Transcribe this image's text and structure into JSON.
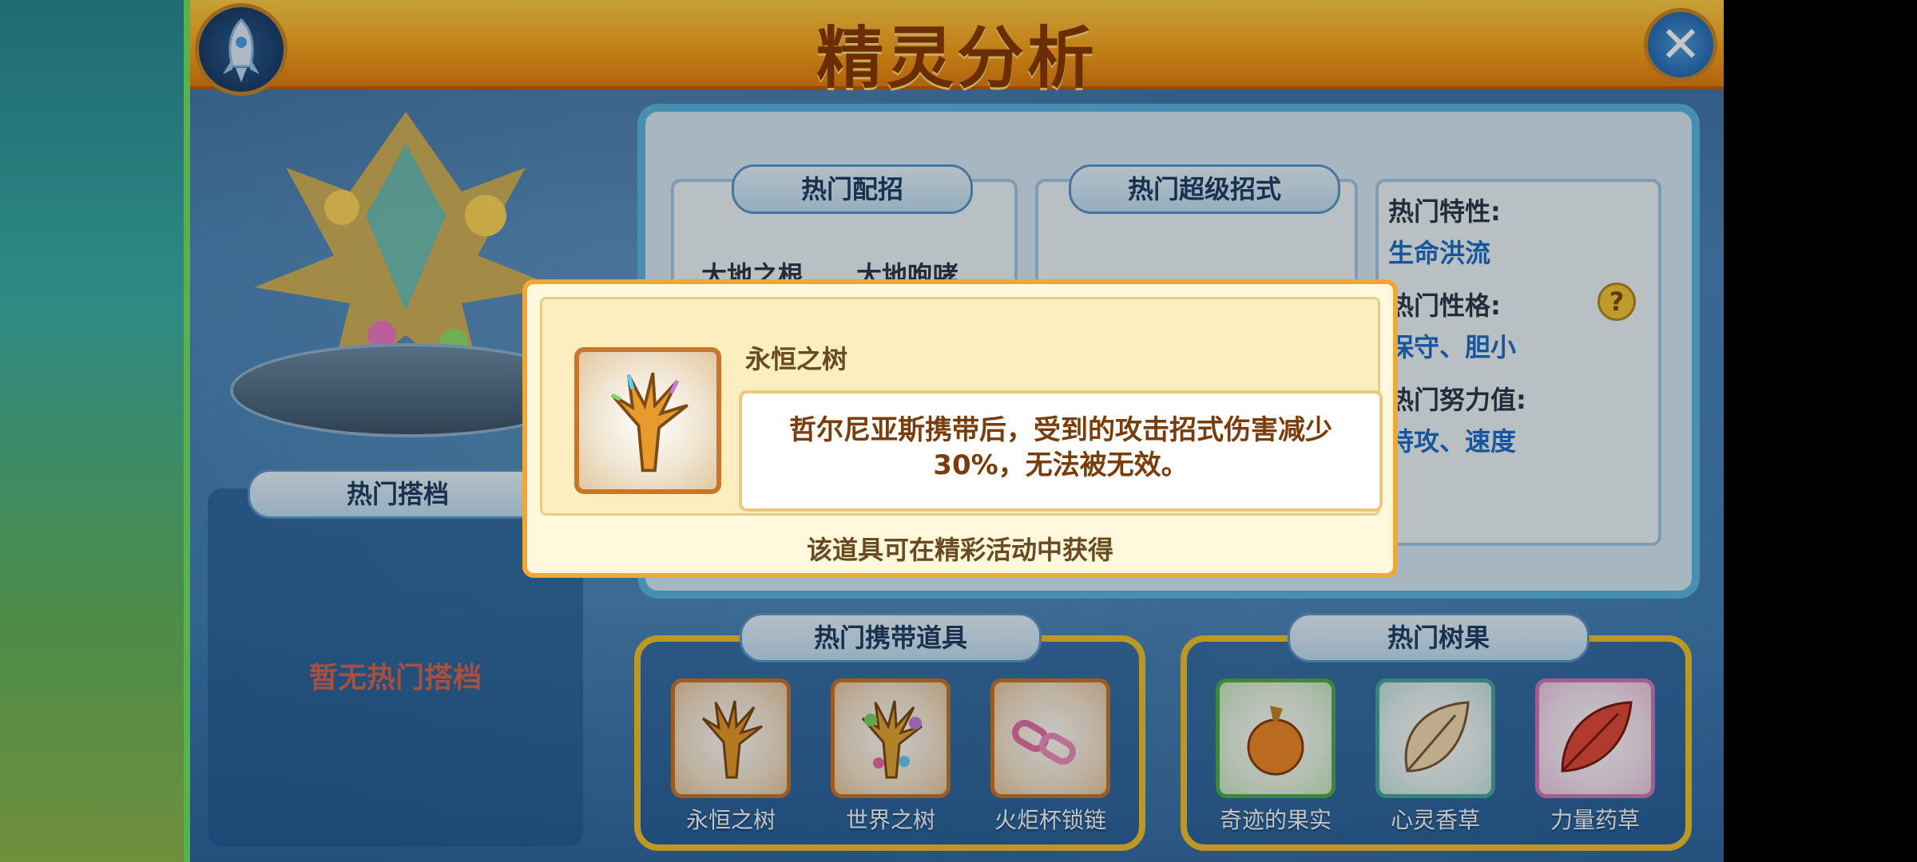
{
  "header": {
    "title": "精灵分析",
    "close_glyph": "✕"
  },
  "icons": {
    "rocket": "rocket-icon",
    "close": "close-icon",
    "help": "help-icon"
  },
  "colors": {
    "title_bar": "#f7a21c",
    "panel": "#4a86bb",
    "accent": "#f2a733",
    "link": "#1e6fc8",
    "empty_text": "#d86650"
  },
  "partners": {
    "heading": "热门搭档",
    "empty_text": "暂无热门搭档"
  },
  "analysis": {
    "popular_moves": {
      "heading": "热门配招",
      "visible_moves": [
        "大地之根",
        "大地咆哮"
      ]
    },
    "popular_super_moves": {
      "heading": "热门超级招式"
    },
    "traits": {
      "ability_label": "热门特性:",
      "ability_value": "生命洪流",
      "nature_label": "热门性格:",
      "nature_value": "保守、胆小",
      "ev_label": "热门努力值:",
      "ev_value": "特攻、速度",
      "help_glyph": "?"
    }
  },
  "held_items": {
    "heading": "热门携带道具",
    "items": [
      {
        "label": "永恒之树",
        "icon": "eternal-tree-icon"
      },
      {
        "label": "世界之树",
        "icon": "world-tree-icon"
      },
      {
        "label": "火炬杯锁链",
        "icon": "chain-icon"
      }
    ]
  },
  "berries": {
    "heading": "热门树果",
    "items": [
      {
        "label": "奇迹的果实",
        "icon": "fruit-icon"
      },
      {
        "label": "心灵香草",
        "icon": "leaf-icon"
      },
      {
        "label": "力量药草",
        "icon": "feather-leaf-icon"
      }
    ]
  },
  "tooltip": {
    "item_name": "永恒之树",
    "description_line1": "哲尔尼亚斯携带后，受到的攻击招式伤害减少",
    "description_line2": "30%，无法被无效。",
    "footer": "该道具可在精彩活动中获得"
  }
}
